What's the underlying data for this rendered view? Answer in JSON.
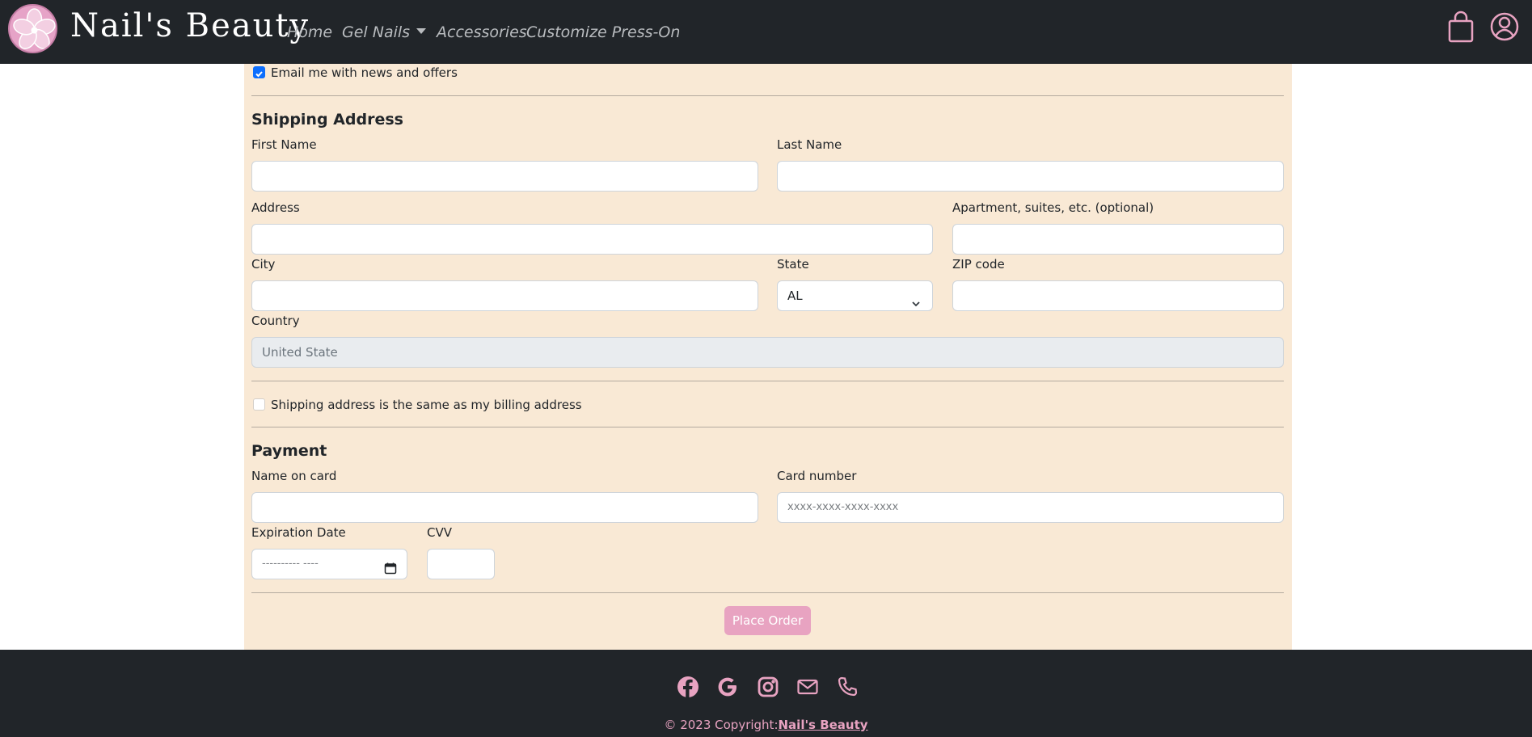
{
  "header": {
    "brand": "Nail's Beauty",
    "nav": [
      {
        "label": "Home"
      },
      {
        "label": "Gel Nails"
      },
      {
        "label": "Accessories"
      },
      {
        "label": "Customize Press-On"
      }
    ],
    "icons": [
      "bag-icon",
      "user-icon"
    ]
  },
  "form": {
    "newsletter": {
      "label": "Email me with news and offers",
      "checked": true
    },
    "shipping": {
      "heading": "Shipping Address",
      "first_name": {
        "label": "First Name",
        "value": ""
      },
      "last_name": {
        "label": "Last Name",
        "value": ""
      },
      "address": {
        "label": "Address",
        "value": ""
      },
      "apartment": {
        "label": "Apartment, suites, etc. (optional)",
        "value": ""
      },
      "city": {
        "label": "City",
        "value": ""
      },
      "state": {
        "label": "State",
        "value": "AL"
      },
      "zip": {
        "label": "ZIP code",
        "value": ""
      },
      "country": {
        "label": "Country",
        "value": "United State"
      }
    },
    "same_address": {
      "label": "Shipping address is the same as my billing address",
      "checked": false
    },
    "payment": {
      "heading": "Payment",
      "name_on_card": {
        "label": "Name on card",
        "value": ""
      },
      "card_number": {
        "label": "Card number",
        "placeholder": "xxxx-xxxx-xxxx-xxxx"
      },
      "expiration": {
        "label": "Expiration Date",
        "placeholder": "---------- ----"
      },
      "cvv": {
        "label": "CVV",
        "value": ""
      }
    },
    "submit_label": "Place Order"
  },
  "footer": {
    "icons": [
      "facebook-icon",
      "google-icon",
      "instagram-icon",
      "mail-icon",
      "phone-icon"
    ],
    "copyright_prefix": "© 2023 Copyright:",
    "copyright_link": "Nail's Beauty"
  },
  "colors": {
    "navbar_bg": "#212529",
    "panel_bg": "#f9e9d5",
    "accent_pink": "#e8a3c1",
    "checkbox_blue": "#0d6efd"
  }
}
